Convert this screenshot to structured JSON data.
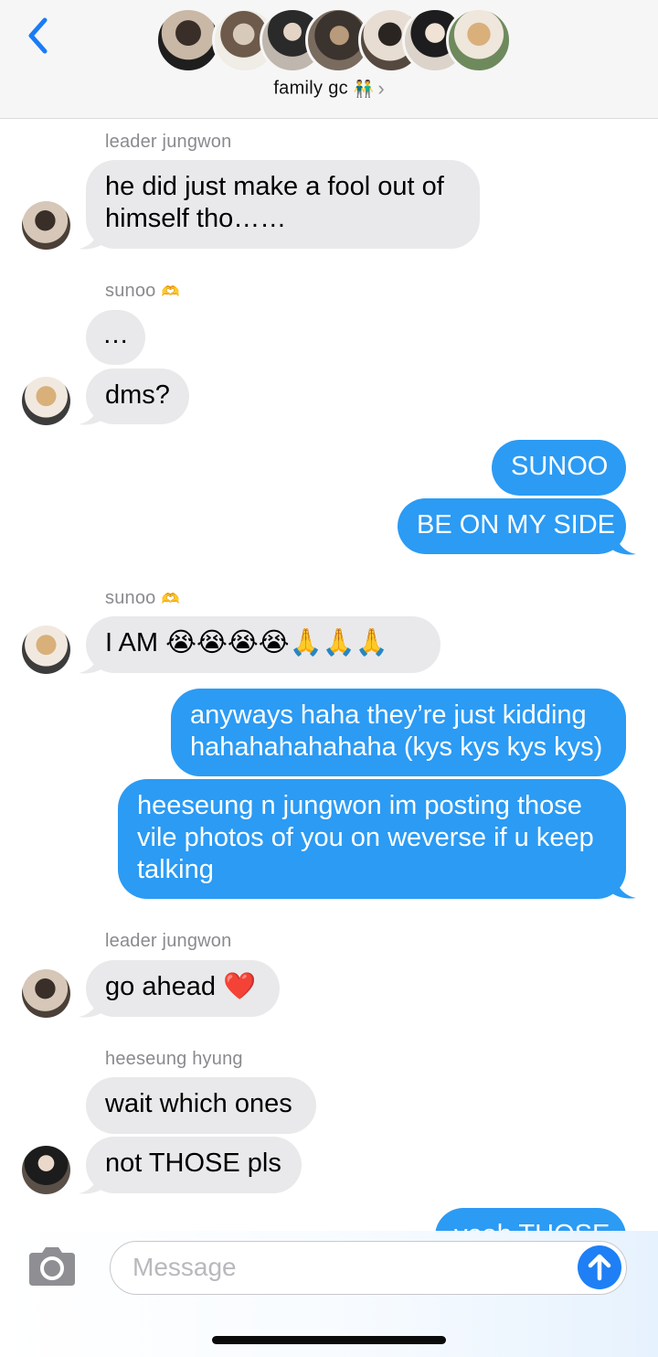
{
  "header": {
    "title": "family gc",
    "title_emoji": "👬",
    "chevron": "›",
    "back_icon": "chevron-left-icon",
    "group_avatar_count": 7
  },
  "messages": [
    {
      "sender": "leader jungwon",
      "text": [
        "he did just make a fool out of",
        "himself tho……"
      ]
    },
    {
      "sender": "sunoo",
      "sender_emoji": "🫶",
      "text": [
        "…"
      ]
    },
    {
      "text": [
        "dms?"
      ]
    },
    {
      "text": [
        "SUNOO"
      ]
    },
    {
      "text": [
        "BE ON MY SIDE"
      ]
    },
    {
      "sender": "sunoo",
      "sender_emoji": "🫶",
      "text": [
        "I AM 😭😭😭😭🙏🙏🙏"
      ]
    },
    {
      "text": [
        "anyways haha they’re just kidding",
        "hahahahahahaha (kys kys kys kys)"
      ]
    },
    {
      "text": [
        "heeseung n jungwon im posting those",
        "vile photos of you on weverse if u keep",
        "talking"
      ]
    },
    {
      "sender": "leader jungwon",
      "text": [
        "go ahead ❤️"
      ]
    },
    {
      "sender": "heeseung hyung",
      "text": [
        "wait which ones"
      ]
    },
    {
      "text": [
        "not THOSE pls"
      ]
    },
    {
      "text": [
        "yeah THOSE"
      ]
    }
  ],
  "composer": {
    "placeholder": "Message",
    "camera_icon": "camera-icon",
    "send_icon": "arrow-up-icon"
  },
  "colors": {
    "incoming_bubble": "#e9e9eb",
    "outgoing_bubble": "#2b9bf4",
    "accent": "#1f7ff5",
    "sender_label": "#8a8a8f"
  }
}
